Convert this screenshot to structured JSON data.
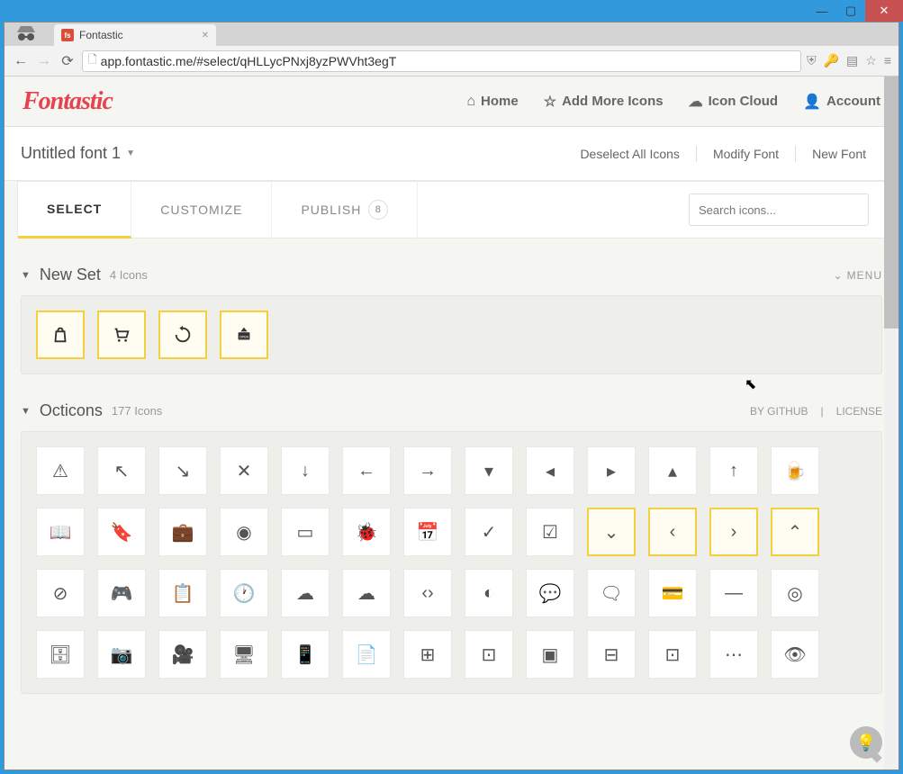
{
  "window": {
    "title": "Fontastic"
  },
  "browser": {
    "url": "app.fontastic.me/#select/qHLLycPNxj8yzPWVht3egT",
    "tab_title": "Fontastic"
  },
  "topnav": {
    "logo": "Fontastic",
    "home": "Home",
    "add": "Add More Icons",
    "cloud": "Icon Cloud",
    "account": "Account"
  },
  "subhead": {
    "fontname": "Untitled font 1",
    "deselect": "Deselect All Icons",
    "modify": "Modify Font",
    "newfont": "New Font"
  },
  "tabs": {
    "select": "SELECT",
    "customize": "CUSTOMIZE",
    "publish": "PUBLISH",
    "publish_badge": "8",
    "search_placeholder": "Search icons..."
  },
  "sections": {
    "newset": {
      "title": "New Set",
      "count": "4 Icons",
      "menu": "MENU"
    },
    "octicons": {
      "title": "Octicons",
      "count": "177 Icons",
      "by": "BY GITHUB",
      "license": "LICENSE"
    }
  }
}
